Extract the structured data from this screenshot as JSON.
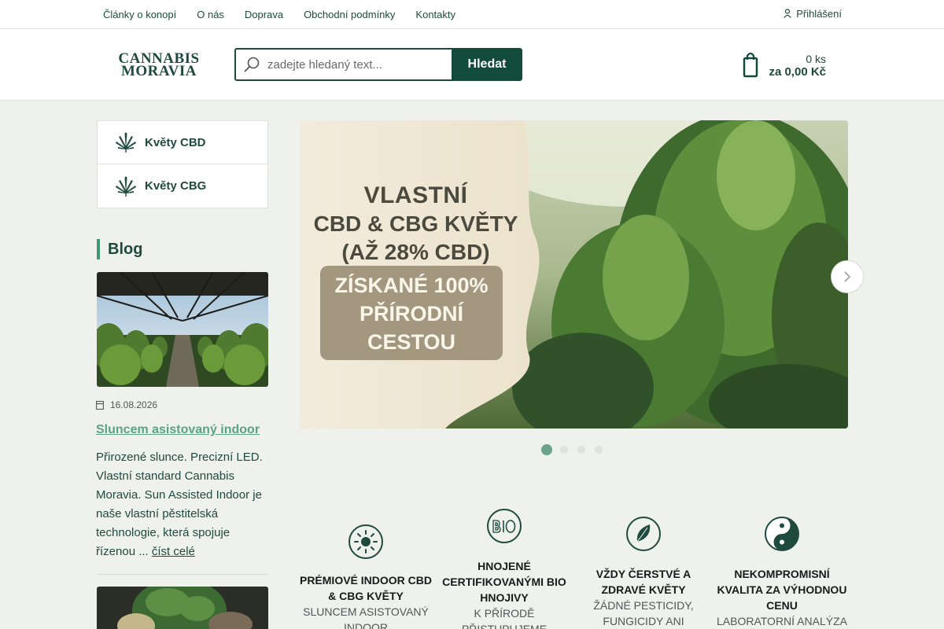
{
  "topnav": {
    "links": [
      "Články o konopí",
      "O nás",
      "Doprava",
      "Obchodní podmínky",
      "Kontakty"
    ],
    "login_label": "Přihlášení"
  },
  "header": {
    "logo_line1": "CANNABIS",
    "logo_line2": "MORAVIA",
    "search_placeholder": "zadejte hledaný text...",
    "search_button": "Hledat",
    "cart_count": "0 ks",
    "cart_total": "za 0,00 Kč"
  },
  "sidebar": {
    "categories": [
      {
        "label": "Květy CBD",
        "icon": "cannabis-leaf-icon"
      },
      {
        "label": "Květy CBG",
        "icon": "cannabis-leaf-icon"
      }
    ]
  },
  "blog": {
    "title": "Blog",
    "date": "16.08.2026",
    "post_title": "Sluncem asistovaný indoor",
    "excerpt": "Přirozené slunce. Precizní LED. Vlastní standard Cannabis Moravia. Sun Assisted Indoor je naše vlastní pěstitelská technologie, která spojuje řízenou ...",
    "read_more": "číst celé"
  },
  "hero": {
    "line1": "VLASTNÍ",
    "line2": "CBD & CBG KVĚTY",
    "line3": "(AŽ 28% CBD)",
    "badge_line1": "ZÍSKANÉ 100%",
    "badge_line2": "PŘÍRODNÍ",
    "badge_line3": "CESTOU",
    "slide_count": 4,
    "active_slide": 1
  },
  "features": [
    {
      "title": "Prémiové indoor CBD & CBG květy",
      "subtitle": "Sluncem asistovaný indoor",
      "icon": "sun-icon"
    },
    {
      "title": "Hnojené certifikovanými BIO hnojivy",
      "subtitle": "K přírodě přistupujeme",
      "icon": "bio-icon"
    },
    {
      "title": "Vždy čerstvé a zdravé květy",
      "subtitle": "Žádné pesticidy, fungicidy ani",
      "icon": "leaf-icon"
    },
    {
      "title": "Nekompromisní kvalita za výhodnou cenu",
      "subtitle": "Laboratorní analýza",
      "icon": "yin-yang-icon"
    }
  ],
  "colors": {
    "brand_dark": "#124a3b",
    "brand_text": "#1f4a3e",
    "accent": "#3d9a6e",
    "link": "#5aa384",
    "page_bg": "#eef1ec"
  }
}
